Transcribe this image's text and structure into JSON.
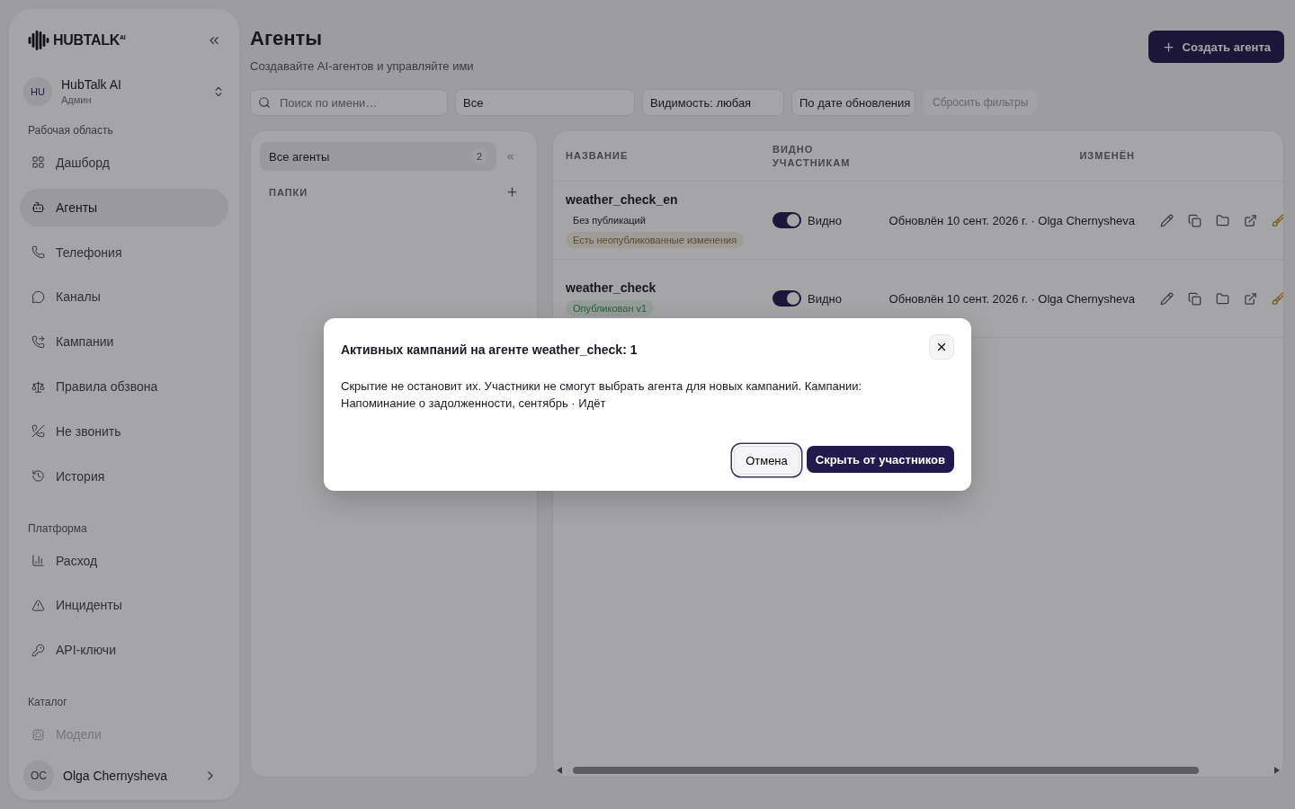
{
  "sidebar": {
    "logo": "HUBTALK$^{AI}$",
    "workspace": {
      "initials": "HU",
      "name": "HubTalk AI",
      "role": "Админ"
    },
    "sections": [
      {
        "title": "Рабочая область",
        "items": [
          {
            "label": "Дашборд",
            "selected": false,
            "disabled": false
          },
          {
            "label": "Агенты",
            "selected": true,
            "disabled": false
          },
          {
            "label": "Телефония",
            "selected": false,
            "disabled": false
          },
          {
            "label": "Каналы",
            "selected": false,
            "disabled": false
          },
          {
            "label": "Кампании",
            "selected": false,
            "disabled": false
          },
          {
            "label": "Правила обзвона",
            "selected": false,
            "disabled": false
          },
          {
            "label": "Не звонить",
            "selected": false,
            "disabled": false
          },
          {
            "label": "История",
            "selected": false,
            "disabled": false
          }
        ]
      },
      {
        "title": "Платформа",
        "items": [
          {
            "label": "Расход",
            "selected": false,
            "disabled": false
          },
          {
            "label": "Инциденты",
            "selected": false,
            "disabled": false
          },
          {
            "label": "API-ключи",
            "selected": false,
            "disabled": false
          }
        ]
      },
      {
        "title": "Каталог",
        "items": [
          {
            "label": "Модели",
            "selected": false,
            "disabled": true
          }
        ]
      }
    ],
    "user": {
      "initials": "OC",
      "name": "Olga Chernysheva"
    }
  },
  "header": {
    "title": "Агенты",
    "subtitle": "Создавайте AI-агентов и управляйте ими",
    "create_button": "Создать агента"
  },
  "filters": {
    "search": {
      "placeholder": "Поиск по имени…"
    },
    "status": "Все",
    "visibility": "Видимость: любая",
    "sort": "По дате обновления",
    "reset": {
      "label": "Сбросить фильтры",
      "disabled": true
    }
  },
  "folders": {
    "all": {
      "label": "Все агенты",
      "count": "2",
      "selected": true
    },
    "heading": "ПАПКИ"
  },
  "table": {
    "columns": [
      "НАЗВАНИЕ",
      "ВИДНО УЧАСТНИКАМ",
      "ИЗМЕНЁН"
    ],
    "rows": [
      {
        "name": "weather_check_en",
        "badges": [
          {
            "label": "Без публикаций",
            "kind": "plain"
          },
          {
            "label": "Есть неопубликованные изменения",
            "kind": "changes"
          }
        ],
        "visible": true,
        "visibility_label": "Видно",
        "updated": "Обновлён 10 сент. 2026 г. · Olga Chernysheva"
      },
      {
        "name": "weather_check",
        "badges": [
          {
            "label": "Опубликован v1",
            "kind": "published"
          }
        ],
        "visible": true,
        "visibility_label": "Видно",
        "updated": "Обновлён 10 сент. 2026 г. · Olga Chernysheva"
      }
    ]
  },
  "dialog": {
    "title": "Активных кампаний на агенте weather_check: 1",
    "body": "Скрытие не остановит их. Участники не смогут выбрать агента для новых кампаний. Кампании: Напоминание о задолженности, сентябрь · Идёт",
    "cancel": "Отмена",
    "confirm": "Скрыть от участников"
  }
}
